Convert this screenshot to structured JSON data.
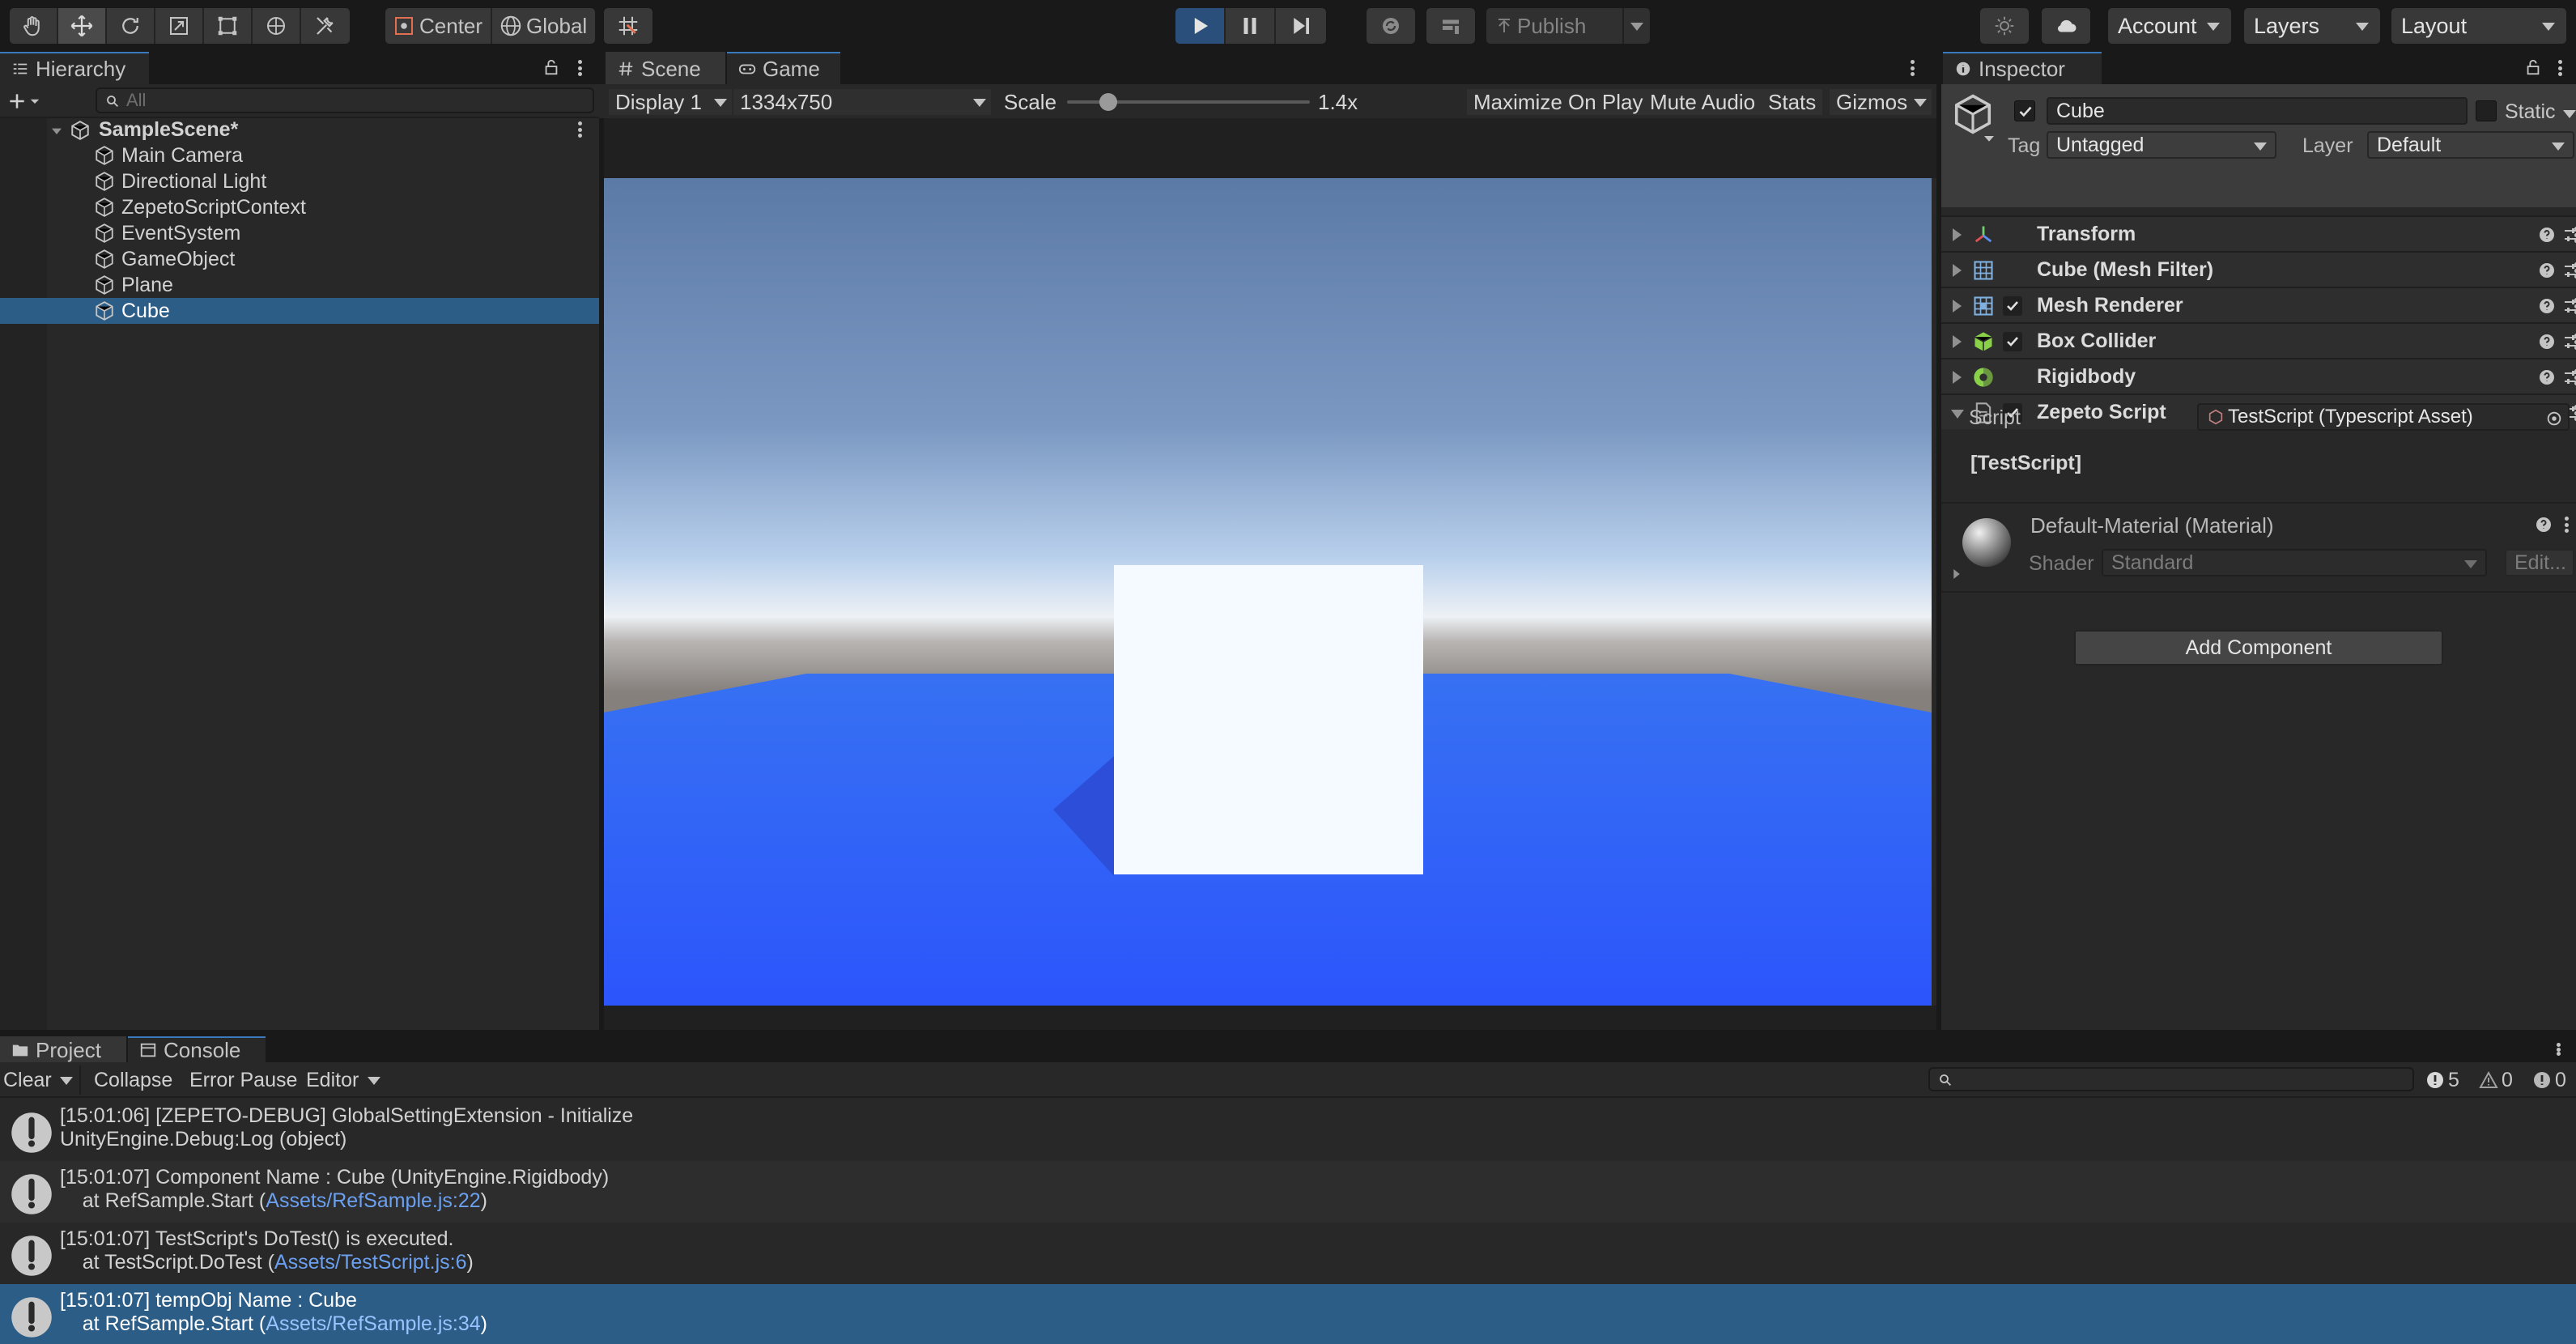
{
  "toolbar": {
    "pivot_label": "Center",
    "space_label": "Global",
    "publish_label": "Publish",
    "account_label": "Account",
    "layers_label": "Layers",
    "layout_label": "Layout"
  },
  "hierarchy": {
    "tab": "Hierarchy",
    "search_placeholder": "All",
    "scene_name": "SampleScene*",
    "items": [
      {
        "label": "Main Camera"
      },
      {
        "label": "Directional Light"
      },
      {
        "label": "ZepetoScriptContext"
      },
      {
        "label": "EventSystem"
      },
      {
        "label": "GameObject"
      },
      {
        "label": "Plane"
      },
      {
        "label": "Cube",
        "selected": true
      }
    ]
  },
  "game_view": {
    "tab_scene": "Scene",
    "tab_game": "Game",
    "display": "Display 1",
    "resolution": "1334x750",
    "scale_label": "Scale",
    "scale_value": "1.4x",
    "maximize": "Maximize On Play",
    "mute": "Mute Audio",
    "stats": "Stats",
    "gizmos": "Gizmos"
  },
  "inspector": {
    "tab": "Inspector",
    "object_name": "Cube",
    "static_label": "Static",
    "tag_label": "Tag",
    "tag_value": "Untagged",
    "layer_label": "Layer",
    "layer_value": "Default",
    "components": [
      {
        "label": "Transform",
        "icon": "transform-icon",
        "checkbox": false,
        "expanded": false
      },
      {
        "label": "Cube (Mesh Filter)",
        "icon": "mesh-filter-icon",
        "checkbox": false,
        "expanded": false
      },
      {
        "label": "Mesh Renderer",
        "icon": "mesh-renderer-icon",
        "checkbox": true,
        "expanded": false
      },
      {
        "label": "Box Collider",
        "icon": "box-collider-icon",
        "checkbox": true,
        "expanded": false
      },
      {
        "label": "Rigidbody",
        "icon": "rigidbody-icon",
        "checkbox": false,
        "expanded": false
      },
      {
        "label": "Zepeto Script",
        "icon": "script-icon",
        "checkbox": true,
        "expanded": true
      }
    ],
    "script_label": "Script",
    "script_value": "TestScript (Typescript Asset)",
    "script_class": "[TestScript]",
    "material_name": "Default-Material (Material)",
    "shader_label": "Shader",
    "shader_value": "Standard",
    "edit_label": "Edit...",
    "add_component": "Add Component"
  },
  "console": {
    "tab_project": "Project",
    "tab_console": "Console",
    "clear": "Clear",
    "collapse": "Collapse",
    "error_pause": "Error Pause",
    "editor": "Editor",
    "count_log": "5",
    "count_warn": "0",
    "count_error": "0",
    "logs": [
      {
        "line1": "[15:01:06] [ZEPETO-DEBUG] GlobalSettingExtension - Initialize",
        "line2_prefix": "UnityEngine.Debug:Log (object)",
        "link": "",
        "line2_suffix": ""
      },
      {
        "line1": "[15:01:07] Component Name : Cube (UnityEngine.Rigidbody)",
        "line2_prefix": "    at RefSample.Start (",
        "link": "Assets/RefSample.js:22",
        "line2_suffix": ")"
      },
      {
        "line1": "[15:01:07] TestScript's DoTest() is executed.",
        "line2_prefix": "    at TestScript.DoTest (",
        "link": "Assets/TestScript.js:6",
        "line2_suffix": ")"
      },
      {
        "line1": "[15:01:07] tempObj Name : Cube",
        "line2_prefix": "    at RefSample.Start (",
        "link": "Assets/RefSample.js:34",
        "line2_suffix": ")"
      }
    ]
  },
  "colors": {
    "accent": "#3a79bb",
    "selection": "#2c5d87",
    "floor": "#2d58fb",
    "link": "#6ba0f0"
  }
}
